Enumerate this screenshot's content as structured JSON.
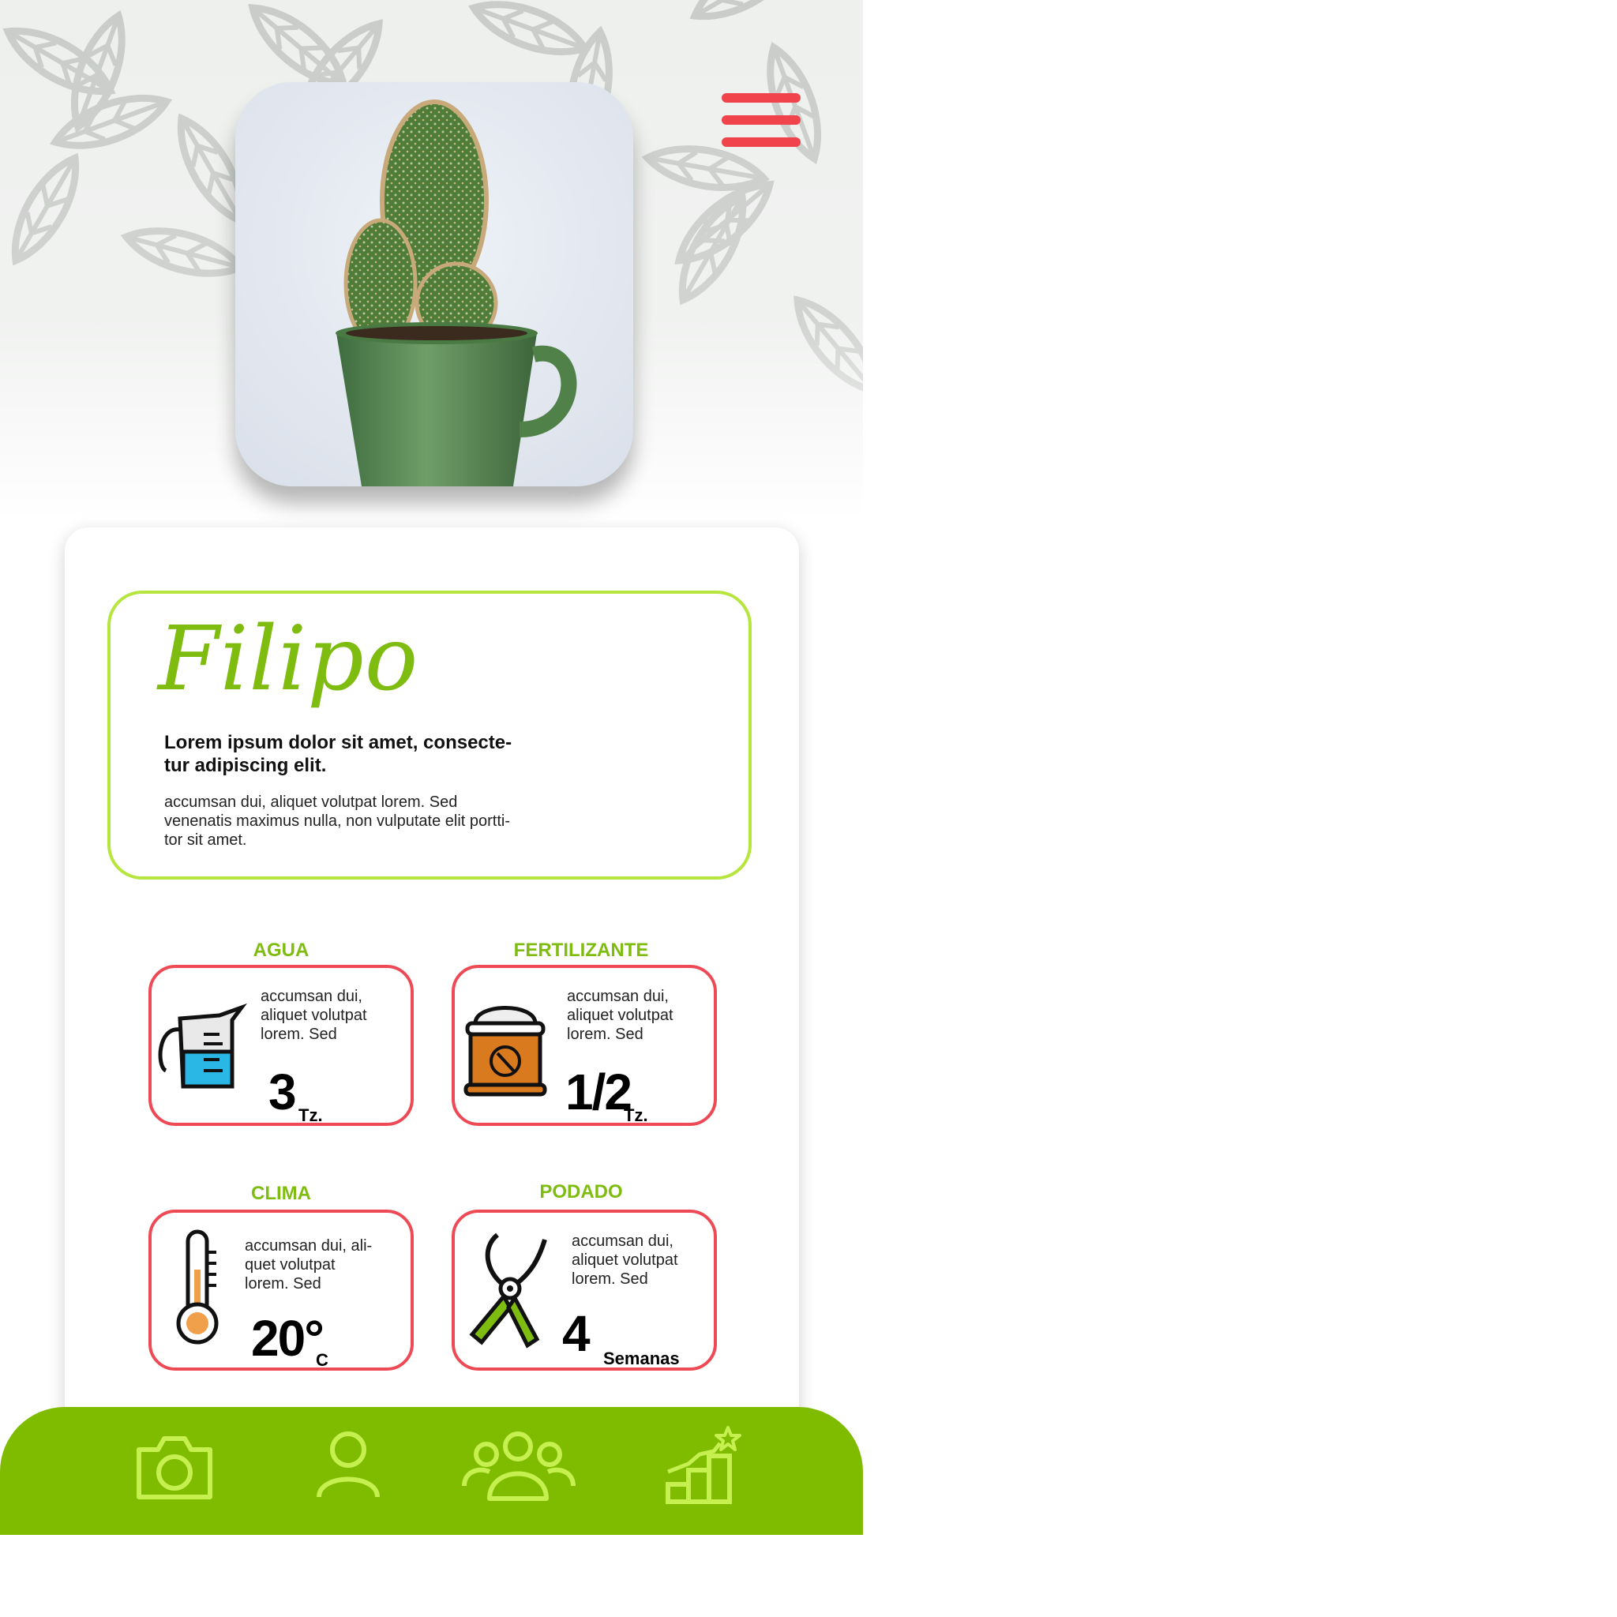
{
  "colors": {
    "accent_green": "#7fbc00",
    "light_green": "#b6e53e",
    "alert_red": "#ee4a55",
    "menu_red": "#f0434b"
  },
  "header": {
    "menu_icon": "hamburger-menu-icon",
    "hero_image": "cactus-in-green-mug-photo"
  },
  "plant": {
    "name": "Filipo",
    "lead_line1": "Lorem ipsum dolor sit amet, consecte-",
    "lead_line2": "tur adipiscing elit.",
    "desc_line1": "accumsan dui, aliquet volutpat lorem. Sed",
    "desc_line2": "venenatis maximus nulla, non vulputate elit portti-",
    "desc_line3": "tor sit amet."
  },
  "care": {
    "agua": {
      "title": "AGUA",
      "icon": "measuring-jug-icon",
      "line1": "accumsan dui,",
      "line2": "aliquet volutpat",
      "line3": "lorem. Sed",
      "value": "3",
      "unit": "Tz."
    },
    "fertilizante": {
      "title": "FERTILIZANTE",
      "icon": "fertilizer-bag-icon",
      "line1": "accumsan dui,",
      "line2": "aliquet volutpat",
      "line3": "lorem. Sed",
      "value": "1/2",
      "unit": "Tz."
    },
    "clima": {
      "title": "CLIMA",
      "icon": "thermometer-icon",
      "line1": "accumsan dui, ali-",
      "line2": "quet volutpat",
      "line3": "lorem. Sed",
      "value": "20°",
      "unit": "C"
    },
    "podado": {
      "title": "PODADO",
      "icon": "pruning-shears-icon",
      "line1": "accumsan dui,",
      "line2": "aliquet volutpat",
      "line3": "lorem. Sed",
      "value": "4",
      "unit": "Semanas"
    }
  },
  "nav": {
    "items": [
      "camera-icon",
      "profile-icon",
      "community-icon",
      "progress-icon"
    ]
  }
}
